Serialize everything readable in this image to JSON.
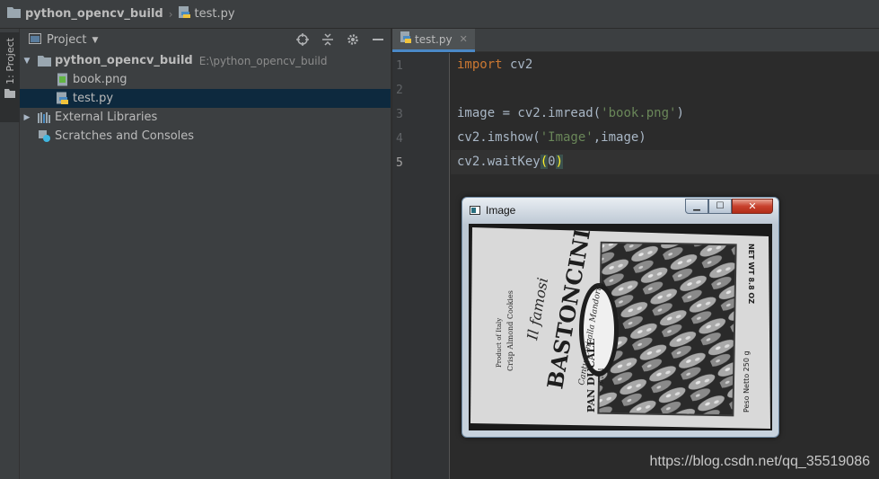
{
  "navbar": {
    "project": "python_opencv_build",
    "file": "test.py"
  },
  "stripe": {
    "project_tab": "1: Project"
  },
  "project_panel": {
    "title": "Project",
    "tree": {
      "root": {
        "name": "python_opencv_build",
        "path": "E:\\python_opencv_build"
      },
      "files": [
        "book.png",
        "test.py"
      ],
      "external": "External Libraries",
      "scratches": "Scratches and Consoles"
    }
  },
  "editor": {
    "tab": "test.py",
    "line_numbers": [
      "1",
      "2",
      "3",
      "4",
      "5"
    ],
    "code": {
      "l1_kw": "import",
      "l1_rest": " cv2",
      "l3_pre": "image = cv2.imread(",
      "l3_str": "'book.png'",
      "l3_post": ")",
      "l4_pre": "cv2.imshow(",
      "l4_str": "'Image'",
      "l4_post": ",image)",
      "l5_pre": "cv2.waitKey",
      "l5_open": "(",
      "l5_arg": "0",
      "l5_close": ")"
    }
  },
  "cv_window": {
    "title": "Image",
    "box_text": {
      "brand": "BASTONCINI",
      "sub1": "Il famosi",
      "sub2": "Cantuccini alla Mandorla",
      "side_left": "Crisp Almond Cookies",
      "side_left2": "Product of Italy",
      "badge1": "PAN DUCALE",
      "badge2": "ATRI",
      "side_right1": "NET WT 8.8 OZ",
      "side_right2": "Peso Netto 250 g"
    }
  },
  "watermark": "https://blog.csdn.net/qq_35519086"
}
